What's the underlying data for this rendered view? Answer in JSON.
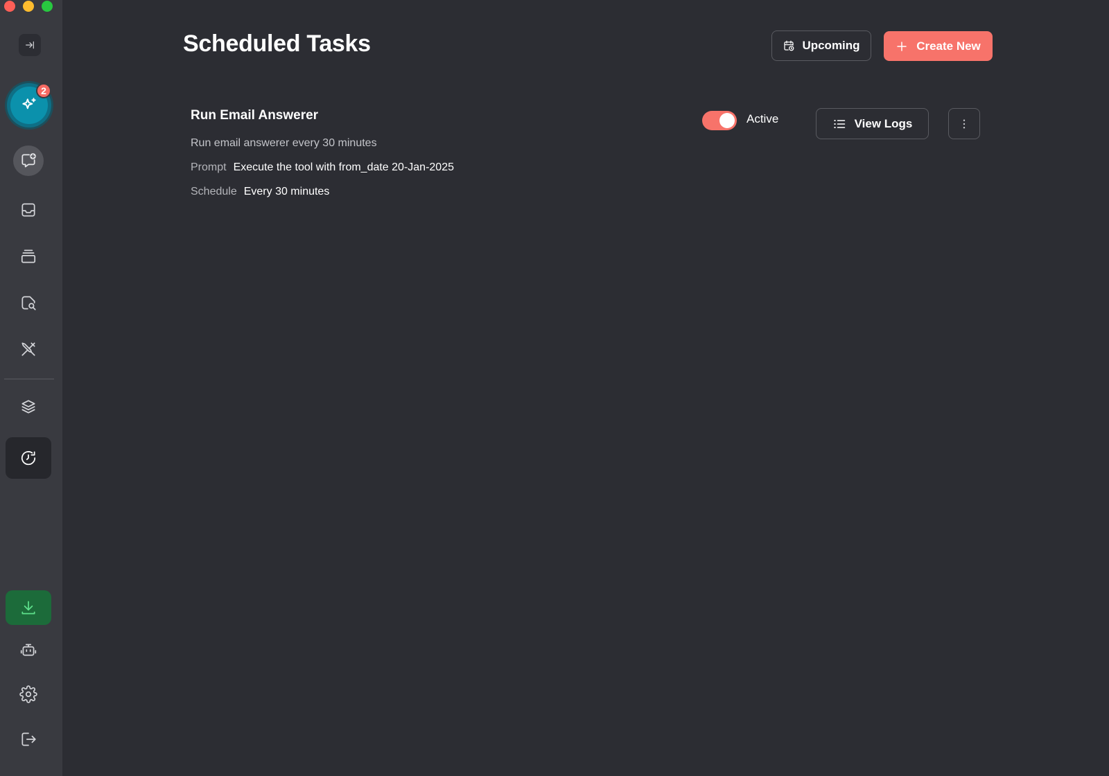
{
  "window": {
    "traffic_lights": [
      "close",
      "minimize",
      "zoom"
    ]
  },
  "sidebar": {
    "collapse_icon": "arrow-right-to-line-icon",
    "ai_assistant": {
      "icon": "sparkles-icon",
      "badge_count": "2"
    },
    "items": [
      {
        "id": "new-chat",
        "icon": "chat-plus-icon"
      },
      {
        "id": "inbox",
        "icon": "inbox-icon"
      },
      {
        "id": "stack",
        "icon": "stack-icon"
      },
      {
        "id": "file-search",
        "icon": "file-search-icon"
      },
      {
        "id": "tools",
        "icon": "tools-icon"
      },
      {
        "id": "layers",
        "icon": "layers-icon"
      },
      {
        "id": "scheduled",
        "icon": "clock-history-icon",
        "active": true
      },
      {
        "id": "download",
        "icon": "download-icon"
      },
      {
        "id": "bot",
        "icon": "bot-icon"
      },
      {
        "id": "settings",
        "icon": "gear-icon"
      },
      {
        "id": "logout",
        "icon": "logout-icon"
      }
    ]
  },
  "header": {
    "title": "Scheduled Tasks",
    "upcoming_label": "Upcoming",
    "create_label": "Create New"
  },
  "tasks": [
    {
      "title": "Run Email Answerer",
      "description": "Run email answerer every 30 minutes",
      "prompt_label": "Prompt",
      "prompt_value": "Execute the tool with from_date 20-Jan-2025",
      "schedule_label": "Schedule",
      "schedule_value": "Every 30 minutes",
      "status_label": "Active",
      "enabled": true,
      "view_logs_label": "View Logs"
    }
  ],
  "colors": {
    "background": "#2c2d33",
    "sidebar": "#393a40",
    "accent": "#f7736a",
    "ai_teal": "#0b91ac",
    "download_green": "#1c6b3a"
  }
}
